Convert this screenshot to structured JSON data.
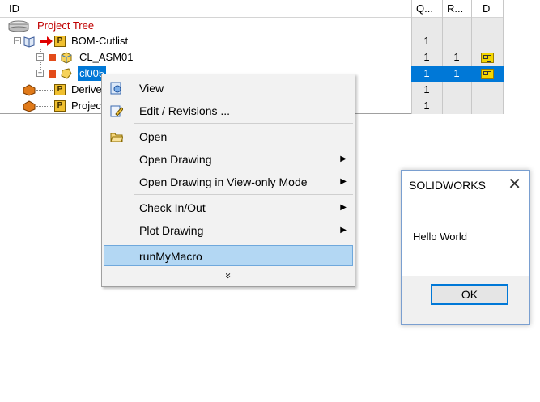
{
  "tree": {
    "columns": {
      "id": "ID",
      "q": "Q...",
      "r": "R...",
      "d": "D"
    },
    "root_label": "Project Tree",
    "rows": [
      {
        "label": "BOM-Cutlist",
        "q": "1",
        "r": ""
      },
      {
        "label": "CL_ASM01",
        "q": "1",
        "r": "1"
      },
      {
        "label": "cl005",
        "q": "1",
        "r": "1"
      },
      {
        "label": "Derive",
        "q": "1",
        "r": ""
      },
      {
        "label": "Projec",
        "q": "1",
        "r": ""
      }
    ]
  },
  "menu": {
    "items": [
      {
        "label": "View"
      },
      {
        "label": "Edit / Revisions ..."
      },
      {
        "label": "Open"
      },
      {
        "label": "Open Drawing"
      },
      {
        "label": "Open Drawing in View-only Mode"
      },
      {
        "label": "Check In/Out"
      },
      {
        "label": "Plot Drawing"
      },
      {
        "label": "runMyMacro"
      }
    ],
    "more_glyph": "»"
  },
  "dialog": {
    "title": "SOLIDWORKS",
    "message": "Hello World",
    "ok_label": "OK",
    "close_glyph": "✕"
  },
  "colors": {
    "selection": "#0078d7",
    "root_label": "#c00000",
    "menu_highlight": "#b3d7f3"
  }
}
